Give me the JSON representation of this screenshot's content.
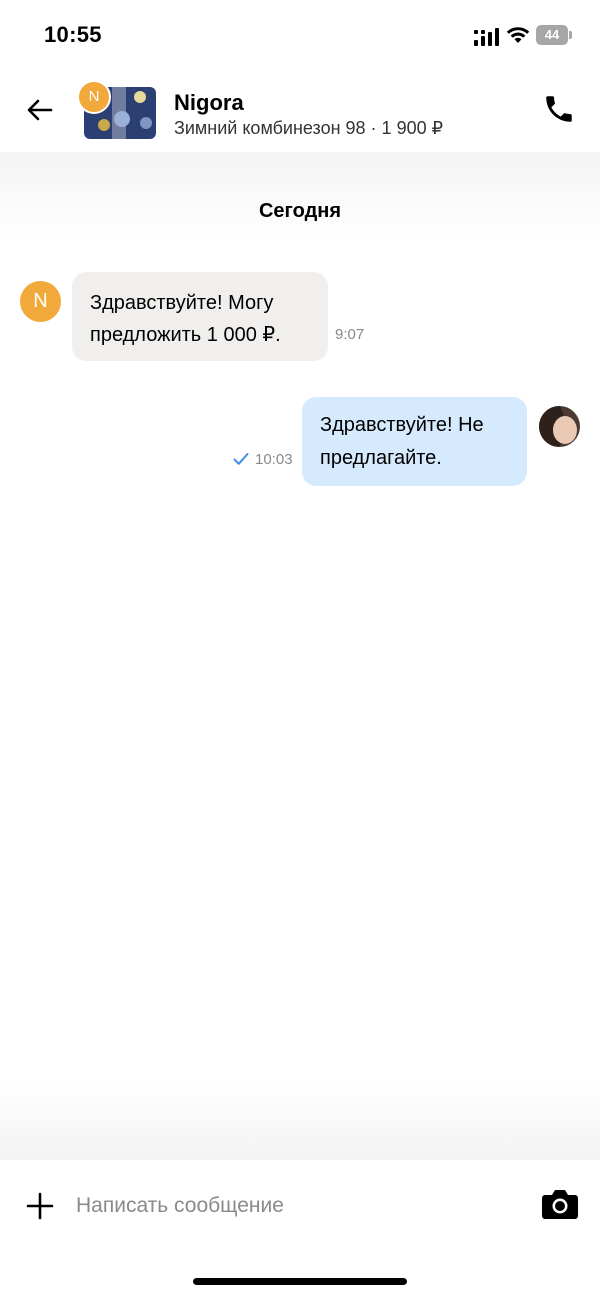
{
  "status_bar": {
    "time": "10:55",
    "battery_level": "44"
  },
  "header": {
    "seller_initial": "N",
    "seller_name": "Nigora",
    "item_subtitle": "Зимний комбинезон 98 · 1 900 ₽",
    "back_icon": "arrow-left-icon",
    "call_icon": "phone-icon"
  },
  "chat": {
    "date_divider": "Сегодня",
    "messages": [
      {
        "direction": "incoming",
        "sender_initial": "N",
        "line1": "Здравствуйте! Могу",
        "line2": "предложить 1 000 ₽.",
        "time": "9:07"
      },
      {
        "direction": "outgoing",
        "line1": "Здравствуйте! Не",
        "line2": "предлагайте.",
        "time": "10:03",
        "status": "read"
      }
    ]
  },
  "composer": {
    "placeholder": "Написать сообщение",
    "value": "",
    "attach_icon": "plus-icon",
    "camera_icon": "camera-icon"
  },
  "colors": {
    "incoming_bubble": "#f0efed",
    "outgoing_bubble": "#d6eafd",
    "avatar_orange": "#f2a93b",
    "check_blue": "#3d8ee6"
  }
}
